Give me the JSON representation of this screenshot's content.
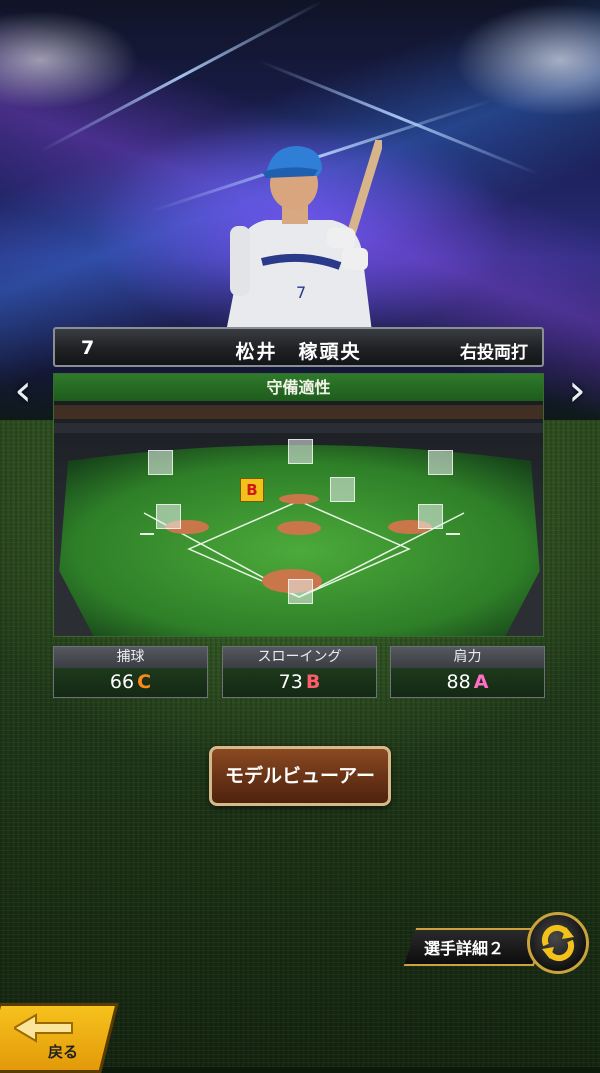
{
  "player": {
    "number": "7",
    "name": "松井　稼頭央",
    "throw_bat": "右投両打"
  },
  "fielding": {
    "header": "守備適性",
    "position_rank": "B"
  },
  "stats": [
    {
      "label": "捕球",
      "value": "66",
      "rank": "C",
      "rank_color": "#ff8a1c"
    },
    {
      "label": "スローイング",
      "value": "73",
      "rank": "B",
      "rank_color": "#ff5d6c"
    },
    {
      "label": "肩力",
      "value": "88",
      "rank": "A",
      "rank_color": "#ff6fc8"
    }
  ],
  "buttons": {
    "model_viewer": "モデルビューアー",
    "player_detail": "選手詳細２",
    "back": "戻る"
  },
  "icons": {
    "prev": "chevron-left-icon",
    "next": "chevron-right-icon",
    "cycle": "cycle-arrows-icon",
    "back": "back-arrow-icon"
  }
}
